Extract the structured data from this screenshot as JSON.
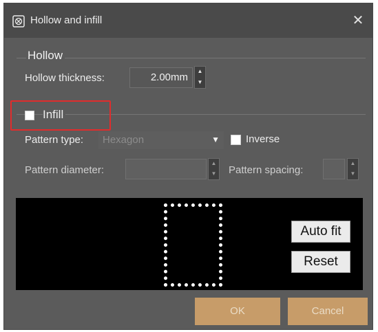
{
  "window": {
    "title": "Hollow and infill",
    "close_label": "✕"
  },
  "hollow": {
    "group_label": "Hollow",
    "thickness_label": "Hollow thickness:",
    "thickness_value": "2.00mm"
  },
  "infill": {
    "checkbox_label": "Infill",
    "checked": false,
    "pattern_type_label": "Pattern type:",
    "pattern_type_value": "Hexagon",
    "inverse_label": "Inverse",
    "pattern_diameter_label": "Pattern diameter:",
    "pattern_spacing_label": "Pattern spacing:"
  },
  "preview": {
    "auto_fit_label": "Auto fit",
    "reset_label": "Reset"
  },
  "footer": {
    "ok_label": "OK",
    "cancel_label": "Cancel"
  },
  "colors": {
    "dialog_bg": "#5b5b5b",
    "titlebar_bg": "#4a4a4a",
    "accent_button": "#c79c69",
    "highlight_border": "#e22c2c"
  },
  "icons": {
    "title": "hollow-infill-icon",
    "close": "close-icon",
    "dropdown": "chevron-down-icon"
  }
}
